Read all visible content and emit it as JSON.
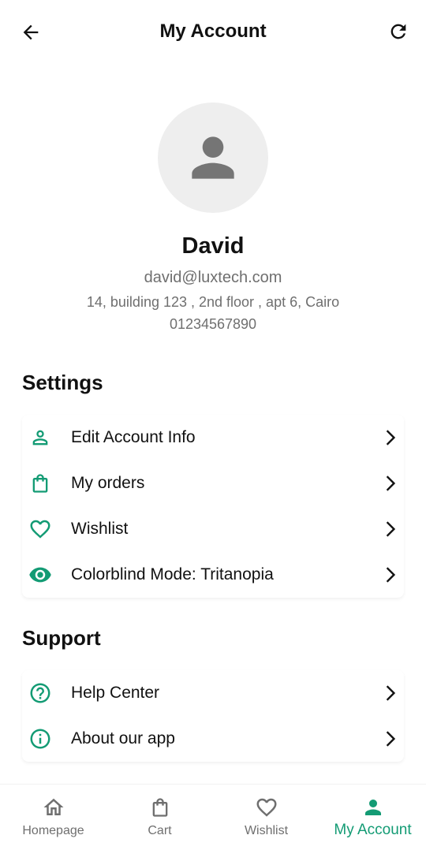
{
  "appbar": {
    "title": "My Account"
  },
  "profile": {
    "name": "David",
    "email": "david@luxtech.com",
    "address": "14, building 123 , 2nd floor , apt 6, Cairo",
    "phone": "01234567890"
  },
  "settings": {
    "title": "Settings",
    "items": [
      {
        "label": "Edit Account Info",
        "icon": "person-outline-icon"
      },
      {
        "label": "My orders",
        "icon": "shopping-bag-icon"
      },
      {
        "label": "Wishlist",
        "icon": "heart-outline-icon"
      },
      {
        "label": "Colorblind Mode: Tritanopia",
        "icon": "eye-icon"
      }
    ]
  },
  "support": {
    "title": "Support",
    "items": [
      {
        "label": "Help Center",
        "icon": "help-circle-icon"
      },
      {
        "label": "About our app",
        "icon": "info-circle-icon"
      }
    ]
  },
  "bottom_nav": {
    "items": [
      {
        "label": "Homepage",
        "icon": "home-icon"
      },
      {
        "label": "Cart",
        "icon": "bag-icon"
      },
      {
        "label": "Wishlist",
        "icon": "heart-icon"
      },
      {
        "label": "My Account",
        "icon": "person-icon",
        "active": true
      }
    ]
  },
  "colors": {
    "accent": "#139b74",
    "muted": "#6f6f6f",
    "avatar_bg": "#eeeeee"
  }
}
